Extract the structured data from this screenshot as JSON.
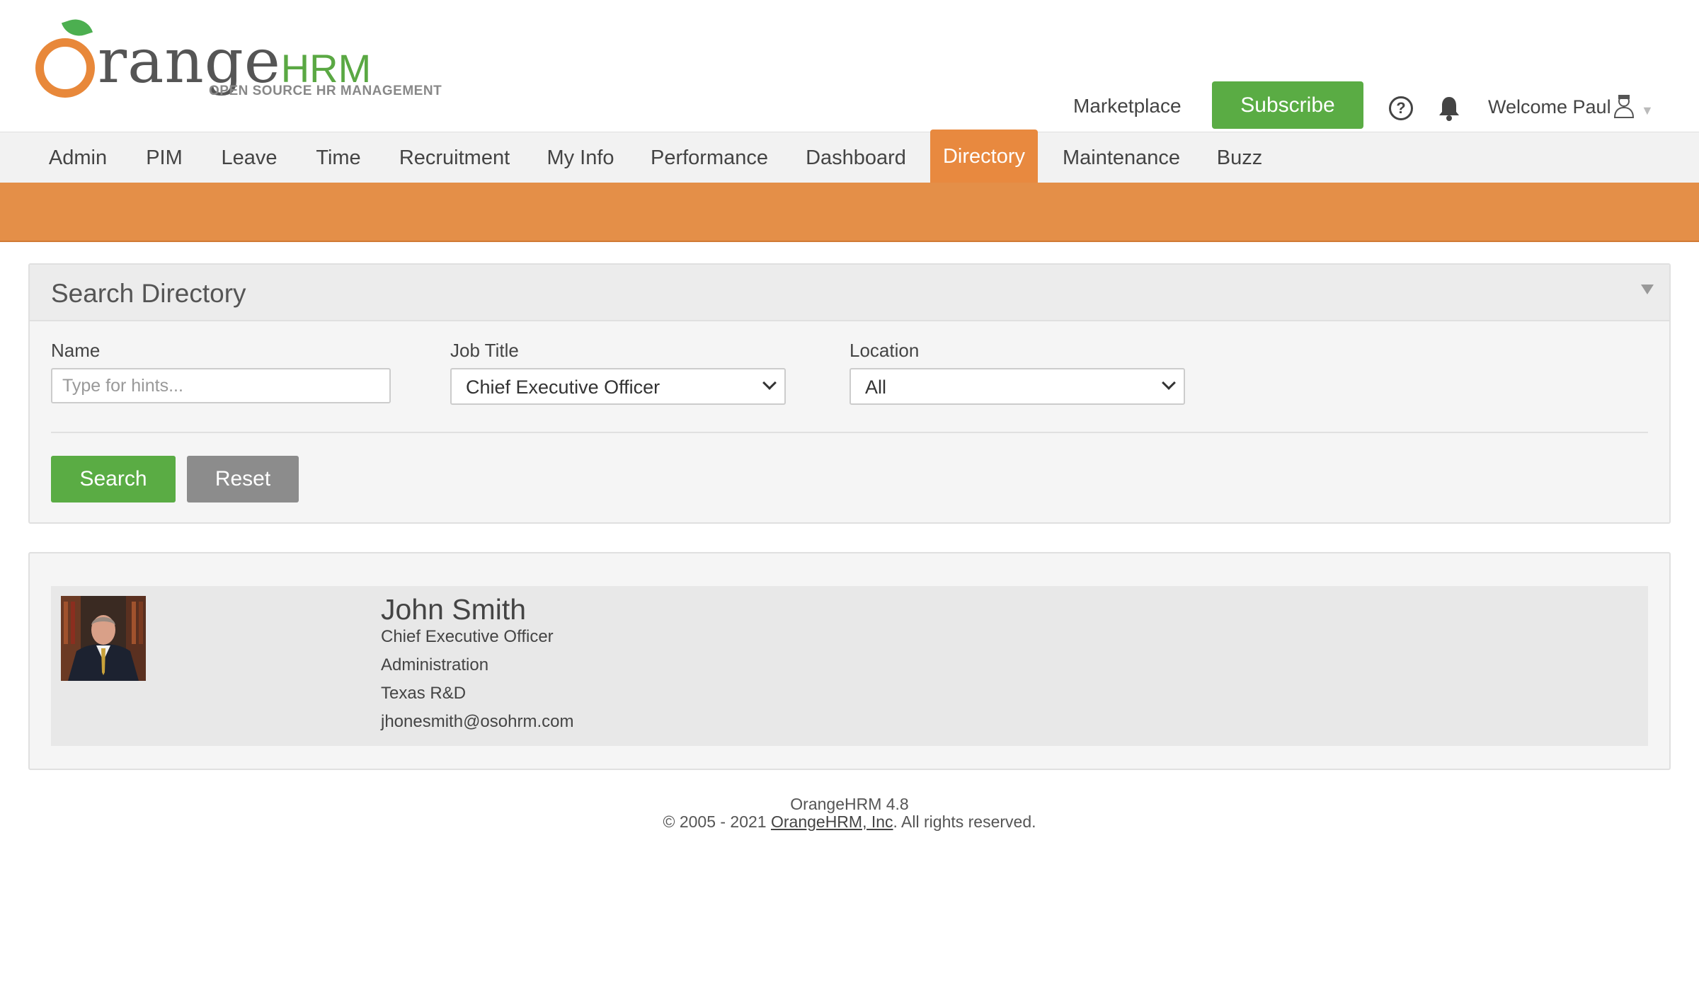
{
  "header": {
    "logo_word": "range",
    "logo_hrm": "HRM",
    "logo_tagline": "OPEN SOURCE HR MANAGEMENT",
    "marketplace_label": "Marketplace",
    "subscribe_label": "Subscribe",
    "welcome_text": "Welcome Paul",
    "icons": [
      "help-icon",
      "bell-icon",
      "user-icon",
      "caret-down-icon"
    ]
  },
  "nav": {
    "items": [
      {
        "label": "Admin"
      },
      {
        "label": "PIM"
      },
      {
        "label": "Leave"
      },
      {
        "label": "Time"
      },
      {
        "label": "Recruitment"
      },
      {
        "label": "My Info"
      },
      {
        "label": "Performance"
      },
      {
        "label": "Dashboard"
      },
      {
        "label": "Directory"
      },
      {
        "label": "Maintenance"
      },
      {
        "label": "Buzz"
      }
    ],
    "active": "Directory"
  },
  "search": {
    "title": "Search Directory",
    "name_label": "Name",
    "name_placeholder": "Type for hints...",
    "job_title_label": "Job Title",
    "job_title_value": "Chief Executive Officer",
    "location_label": "Location",
    "location_value": "All",
    "search_button": "Search",
    "reset_button": "Reset"
  },
  "results": [
    {
      "name": "John Smith",
      "job_title": "Chief Executive Officer",
      "department": "Administration",
      "location": "Texas R&D",
      "email": "jhonesmith@osohrm.com"
    }
  ],
  "footer": {
    "version": "OrangeHRM 4.8",
    "copyright_prefix": "© 2005 - 2021 ",
    "company_link": "OrangeHRM, Inc",
    "copyright_suffix": ". All rights reserved."
  },
  "colors": {
    "accent_orange": "#e8893f",
    "band_orange": "#e48f48",
    "button_green": "#5aac44",
    "button_gray": "#8c8c8c"
  }
}
